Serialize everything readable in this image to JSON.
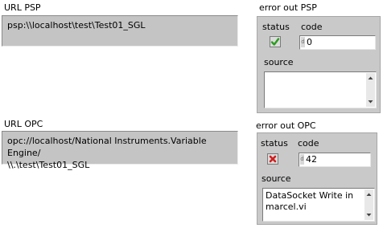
{
  "url_psp": {
    "label": "URL PSP",
    "value": "psp:\\\\localhost\\test\\Test01_SGL"
  },
  "error_psp": {
    "label": "error out PSP",
    "status_label": "status",
    "status": "ok",
    "code_label": "code",
    "radix": "d",
    "code": "0",
    "source_label": "source",
    "source": ""
  },
  "url_opc": {
    "label": "URL OPC",
    "value": "opc://localhost/National Instruments.Variable Engine/\n\\\\.\\test\\Test01_SGL"
  },
  "error_opc": {
    "label": "error out OPC",
    "status_label": "status",
    "status": "error",
    "code_label": "code",
    "radix": "d",
    "code": "42",
    "source_label": "source",
    "source": "DataSocket Write in\nmarcel.vi"
  },
  "colors": {
    "ok_check": "#2a9d1e",
    "error_x": "#d02020",
    "panel_gray": "#c4c4c4"
  },
  "icons": {
    "ok": "check-icon",
    "error": "x-icon"
  }
}
